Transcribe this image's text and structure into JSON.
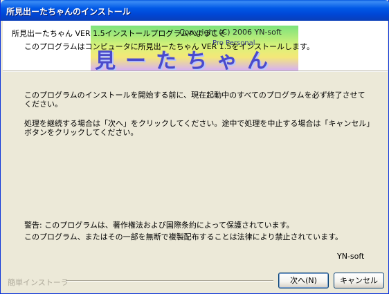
{
  "window": {
    "title": "所見出ーたちゃんのインストール"
  },
  "header": {
    "title": "所見出ーたちゃん VER 1.5インストールプログラムへようこそ",
    "subtitle": "このプログラムはコンピュータに所見出ーたちゃん VER 1.5をインストールします。",
    "banner": {
      "copyright": "Copyright (C) 2006 YN-soft",
      "sub_text": "Pro Personal",
      "art_text": "見ーたちゃん"
    }
  },
  "body": {
    "paragraph1": "このプログラムのインストールを開始する前に、現在起動中のすべてのプログラムを必ず終了させてください。",
    "paragraph2": "処理を継続する場合は「次へ」をクリックしてください。途中で処理を中止する場合は「キャンセル」ボタンをクリックしてください。",
    "warning_line1": "警告: このプログラムは、著作権法および国際条約によって保護されています。",
    "warning_line2": "このプログラム、またはその一部を無断で複製配布することは法律により禁止されています。",
    "author": "YN-soft"
  },
  "footer": {
    "installer_label": "簡単インストーラ",
    "next_button": "次へ(N)",
    "cancel_button": "キャンセル"
  }
}
